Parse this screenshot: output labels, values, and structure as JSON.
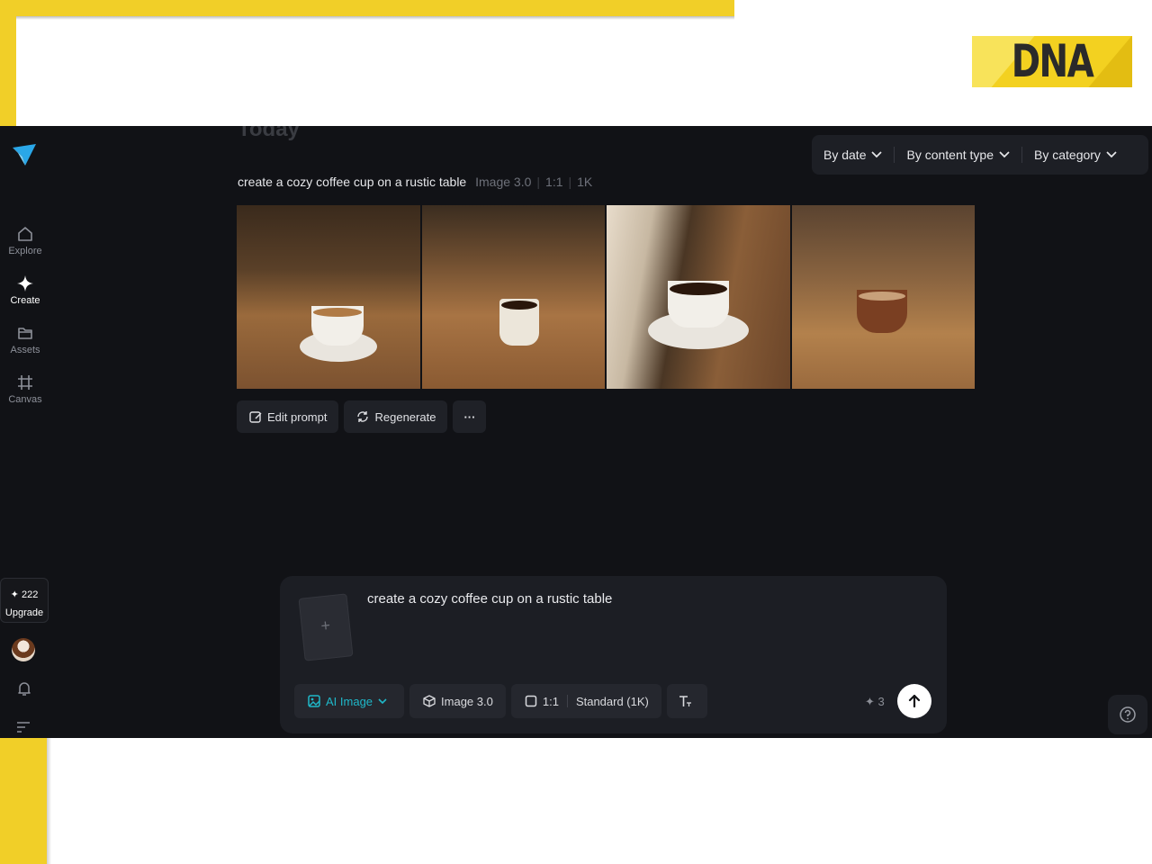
{
  "branding": {
    "logo_text": "DNA"
  },
  "sidebar": {
    "items": [
      {
        "label": "Explore",
        "icon": "home-icon"
      },
      {
        "label": "Create",
        "icon": "sparkle-icon"
      },
      {
        "label": "Assets",
        "icon": "folder-icon"
      },
      {
        "label": "Canvas",
        "icon": "canvas-icon"
      }
    ],
    "active": "Create",
    "credits": "222",
    "upgrade_label": "Upgrade"
  },
  "main": {
    "section_title": "Today",
    "filters": [
      {
        "label": "By date"
      },
      {
        "label": "By content type"
      },
      {
        "label": "By category"
      }
    ],
    "generation": {
      "prompt": "create a cozy coffee cup on a rustic table",
      "model": "Image 3.0",
      "ratio": "1:1",
      "resolution": "1K"
    },
    "actions": {
      "edit_prompt": "Edit prompt",
      "regenerate": "Regenerate",
      "more": "···"
    }
  },
  "composer": {
    "prompt_value": "create a cozy coffee cup on a rustic table",
    "add_reference": "+",
    "mode_label": "AI Image",
    "model_label": "Image 3.0",
    "ratio_label": "1:1",
    "quality_label": "Standard (1K)",
    "cost": "3"
  },
  "colors": {
    "accent": "#1fb8c9",
    "app_background": "#111216",
    "frame_yellow": "#f1cf28"
  }
}
